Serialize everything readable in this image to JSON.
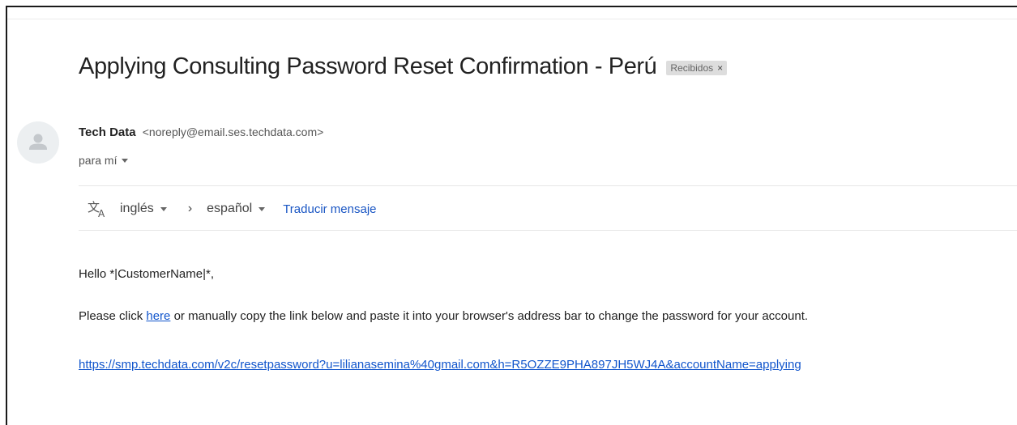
{
  "email": {
    "subject": "Applying Consulting Password Reset Confirmation - Perú",
    "label": {
      "text": "Recibidos",
      "close_glyph": "×"
    },
    "sender": {
      "name": "Tech Data",
      "email": "<noreply@email.ses.techdata.com>",
      "avatar_icon": "person-avatar-icon"
    },
    "recipient_text": "para mí"
  },
  "translate": {
    "icon": "translate-icon",
    "source_lang": "inglés",
    "separator": "›",
    "target_lang": "español",
    "action": "Traducir mensaje"
  },
  "body": {
    "greeting": "Hello *|CustomerName|*,",
    "instruction_before": "Please click ",
    "instruction_link": "here",
    "instruction_after": " or manually copy the link below and paste it into your browser's address bar to change the password for your account.",
    "reset_url": "https://smp.techdata.com/v2c/resetpassword?u=lilianasemina%40gmail.com&h=R5OZZE9PHA897JH5WJ4A&accountName=applying"
  },
  "colors": {
    "link": "#1155cc",
    "chip_bg": "#dddddd",
    "text": "#222222"
  }
}
